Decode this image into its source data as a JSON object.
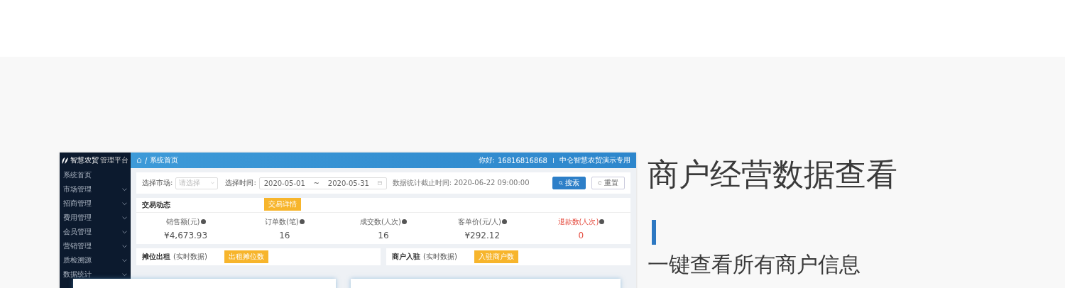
{
  "brand": {
    "name": "智慧农贸",
    "sub": "管理平台"
  },
  "sidebar": {
    "items": [
      {
        "label": "系统首页",
        "expandable": false
      },
      {
        "label": "市场管理",
        "expandable": true
      },
      {
        "label": "招商管理",
        "expandable": true
      },
      {
        "label": "费用管理",
        "expandable": true
      },
      {
        "label": "会员管理",
        "expandable": true
      },
      {
        "label": "营销管理",
        "expandable": true
      },
      {
        "label": "质检溯源",
        "expandable": true
      },
      {
        "label": "数据统计",
        "expandable": true
      }
    ]
  },
  "header": {
    "separator": "/",
    "breadcrumb": "系统首页",
    "greeting": "你好:",
    "phone": "16816816868",
    "account": "中仑智慧农贸演示专用"
  },
  "filters": {
    "market_label": "选择市场:",
    "market_placeholder": "请选择",
    "time_label": "选择时间:",
    "start": "2020-05-01",
    "separator": "~",
    "end": "2020-05-31",
    "note": "数据统计截止时间: 2020-06-22 09:00:00",
    "search": "搜索",
    "reset": "重置"
  },
  "trade": {
    "title": "交易动态",
    "callout": "交易详情",
    "metrics": [
      {
        "label": "销售额(元)",
        "value": "¥4,673.93",
        "alert": false
      },
      {
        "label": "订单数(笔)",
        "value": "16",
        "alert": false
      },
      {
        "label": "成交数(人次)",
        "value": "16",
        "alert": false
      },
      {
        "label": "客单价(元/人)",
        "value": "¥292.12",
        "alert": false
      },
      {
        "label": "退款数(人次)",
        "value": "0",
        "alert": true
      }
    ]
  },
  "panels": [
    {
      "title": "摊位出租",
      "note": "(实时数据)",
      "callout": "出租摊位数"
    },
    {
      "title": "商户入驻",
      "note": "(实时数据)",
      "callout": "入驻商户数"
    }
  ],
  "feature": {
    "title": "商户经营数据查看",
    "subtitle": "一键查看所有商户信息"
  }
}
